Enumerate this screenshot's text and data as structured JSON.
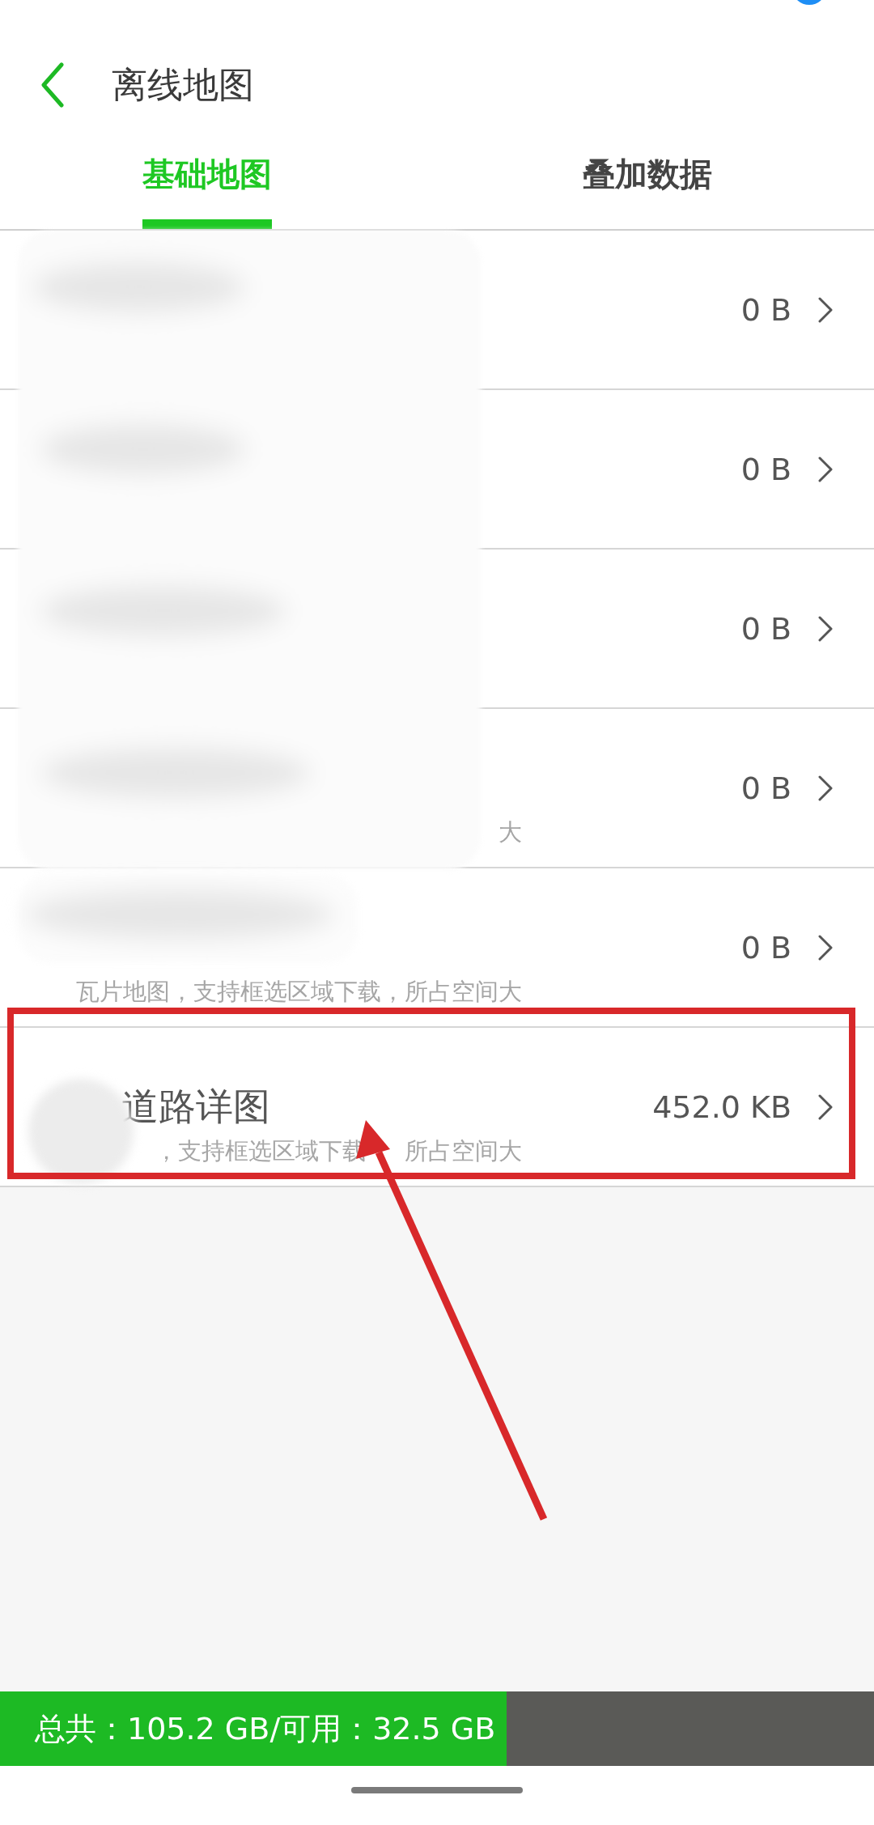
{
  "header": {
    "title": "离线地图"
  },
  "tabs": [
    {
      "label": "基础地图",
      "selected": true
    },
    {
      "label": "叠加数据",
      "selected": false
    }
  ],
  "rows": [
    {
      "size": "0 B"
    },
    {
      "size": "0 B"
    },
    {
      "size": "0 B"
    },
    {
      "size": "0 B",
      "subtitle": [
        "大"
      ]
    },
    {
      "size": "0 B",
      "subtitle": [
        "瓦片地图，支持框选区域下载，所占空间大"
      ]
    },
    {
      "size": "452.0 KB",
      "title": "道路详图",
      "subtitle": [
        "，支持框选区域下载",
        "所占空间大"
      ]
    }
  ],
  "storage": {
    "text": "总共：105.2 GB/可用：32.5 GB",
    "level": 0.58
  }
}
